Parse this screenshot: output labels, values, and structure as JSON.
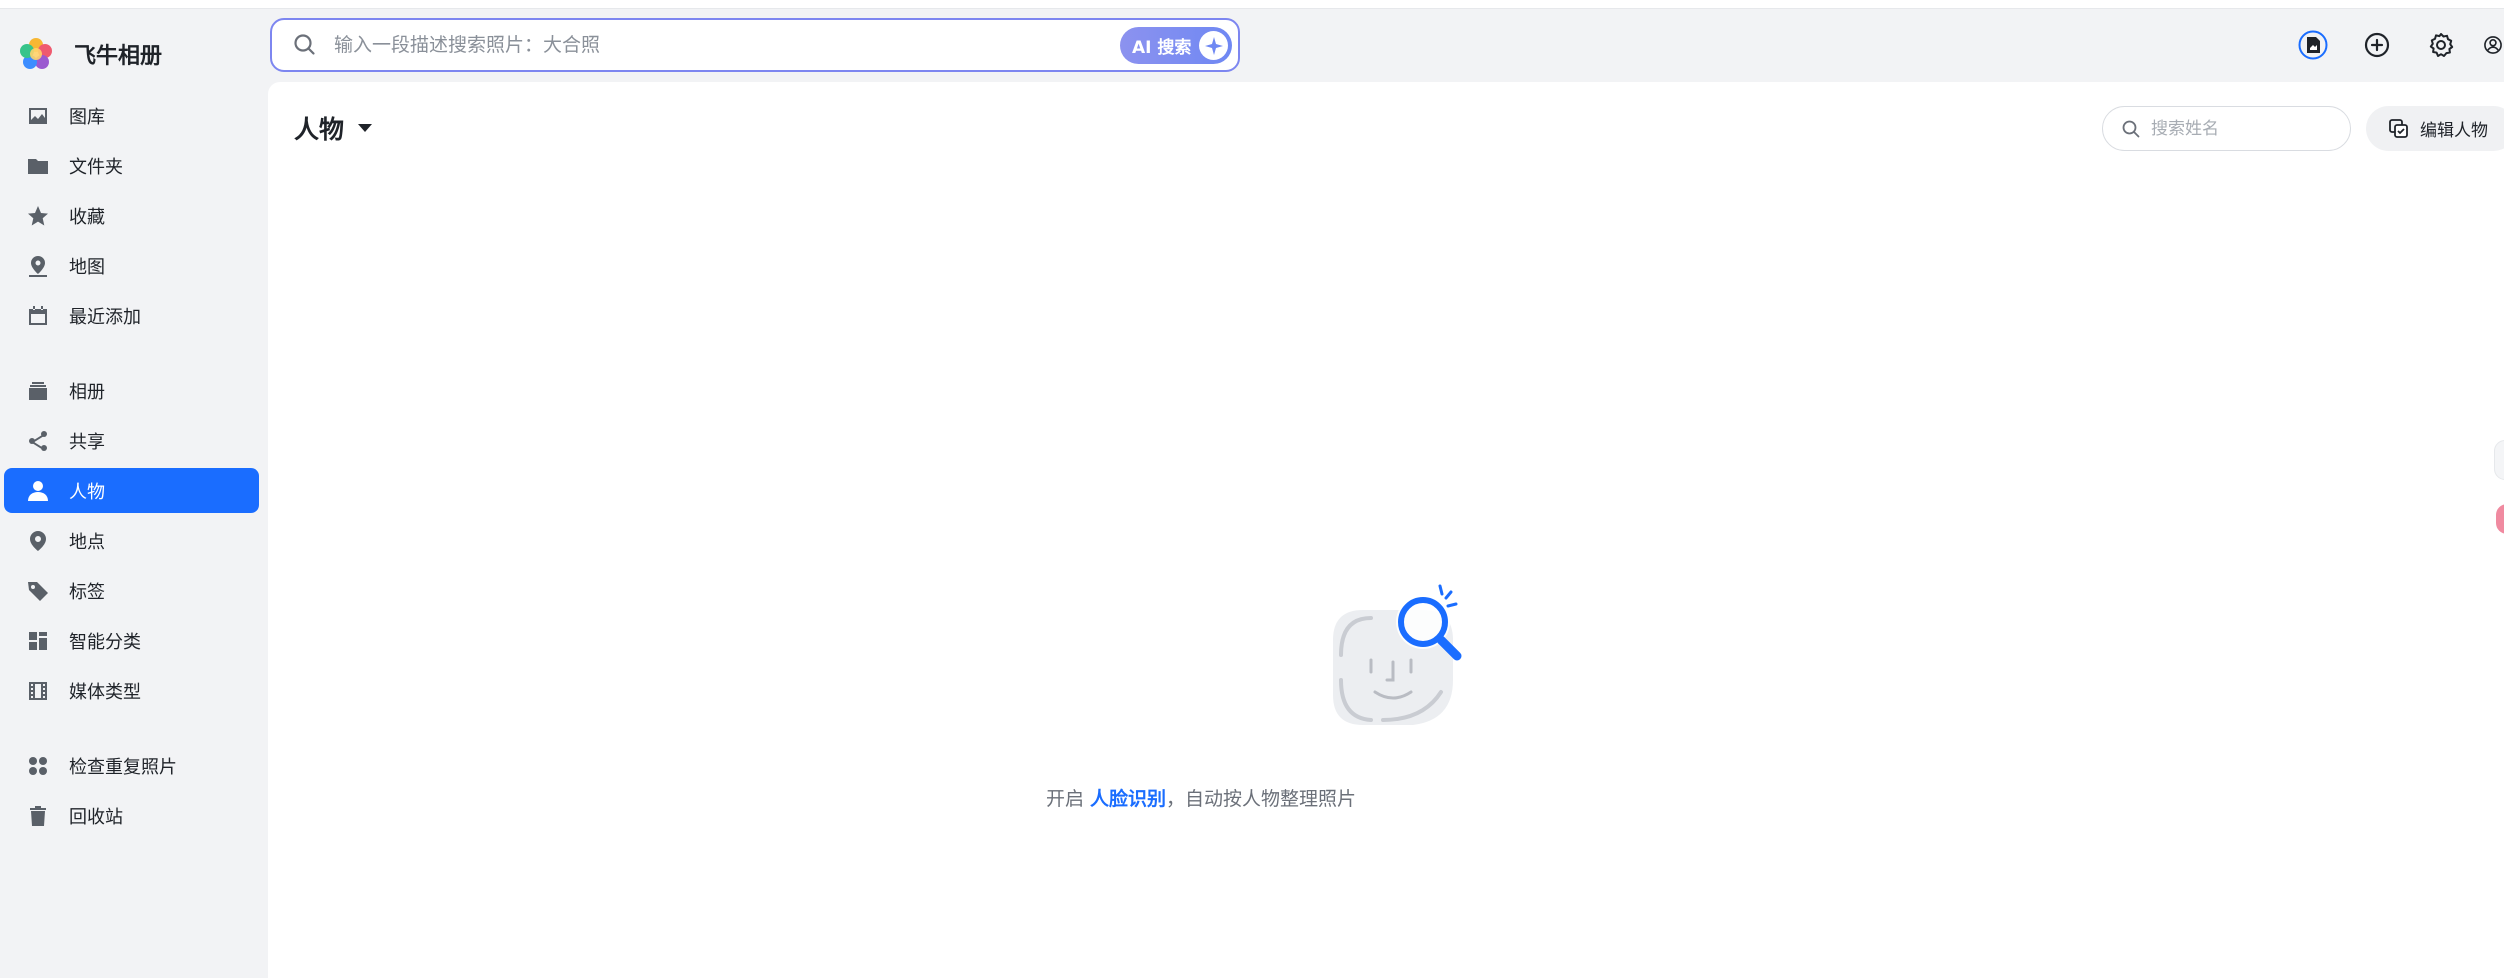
{
  "app": {
    "title": "飞牛相册"
  },
  "search": {
    "placeholder": "输入一段描述搜索照片：大合照",
    "ai_button": "AI 搜索"
  },
  "sidebar": {
    "items": [
      {
        "label": "图库",
        "icon": "image-icon"
      },
      {
        "label": "文件夹",
        "icon": "folder-icon"
      },
      {
        "label": "收藏",
        "icon": "star-icon"
      },
      {
        "label": "地图",
        "icon": "map-pin-icon"
      },
      {
        "label": "最近添加",
        "icon": "calendar-icon"
      },
      {
        "label": "相册",
        "icon": "album-icon"
      },
      {
        "label": "共享",
        "icon": "share-icon"
      },
      {
        "label": "人物",
        "icon": "person-icon",
        "active": true
      },
      {
        "label": "地点",
        "icon": "location-icon"
      },
      {
        "label": "标签",
        "icon": "tag-icon"
      },
      {
        "label": "智能分类",
        "icon": "grid-icon"
      },
      {
        "label": "媒体类型",
        "icon": "film-icon"
      },
      {
        "label": "检查重复照片",
        "icon": "duplicate-icon"
      },
      {
        "label": "回收站",
        "icon": "trash-icon"
      }
    ]
  },
  "header_icons": [
    "upload-task-icon",
    "add-icon",
    "settings-icon",
    "user-icon"
  ],
  "main": {
    "title": "人物",
    "name_search_placeholder": "搜索姓名",
    "edit_button": "编辑人物",
    "empty": {
      "prefix": "开启 ",
      "link": "人脸识别",
      "suffix": "，自动按人物整理照片"
    }
  },
  "colors": {
    "accent": "#1a6dff",
    "ai_gradient_start": "#8c92ef",
    "ai_gradient_end": "#6f88f3"
  }
}
